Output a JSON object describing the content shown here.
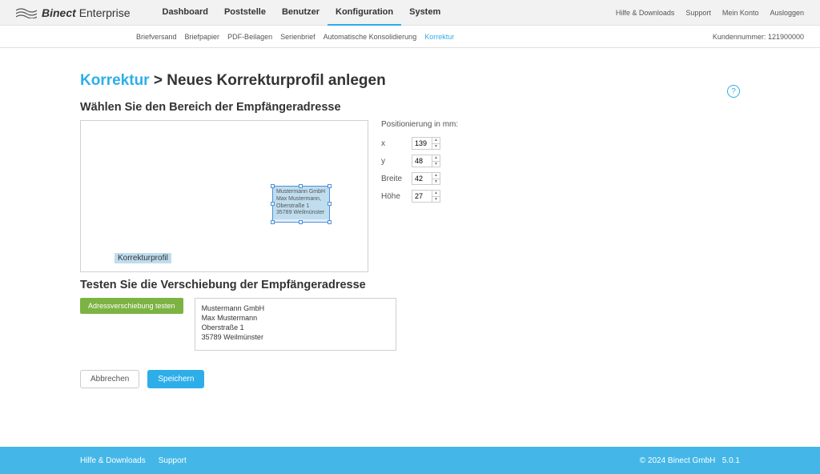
{
  "brand": {
    "bold": "Binect",
    "light": "Enterprise"
  },
  "main_nav": {
    "dashboard": "Dashboard",
    "poststelle": "Poststelle",
    "benutzer": "Benutzer",
    "konfiguration": "Konfiguration",
    "system": "System"
  },
  "top_right": {
    "hilfe": "Hilfe & Downloads",
    "support": "Support",
    "konto": "Mein Konto",
    "ausloggen": "Ausloggen"
  },
  "sub_nav": {
    "briefversand": "Briefversand",
    "briefpapier": "Briefpapier",
    "pdf": "PDF-Beilagen",
    "serienbrief": "Serienbrief",
    "auto": "Automatische Konsolidierung",
    "korrektur": "Korrektur"
  },
  "kundennummer_label": "Kundennummer: ",
  "kundennummer_value": "121900000",
  "breadcrumb": {
    "link": "Korrektur",
    "sep": " > ",
    "current": "Neues Korrekturprofil anlegen"
  },
  "section1_heading": "Wählen Sie den Bereich der Empfängeradresse",
  "preview_addr": {
    "l1": "Mustermann GmbH",
    "l2": "Max Mustermann,",
    "l3": "Oberstraße 1",
    "l4": "35789 Weilmünster"
  },
  "profile_label": "Korrekturprofil",
  "positioning": {
    "title": "Positionierung in mm:",
    "x_label": "x",
    "y_label": "y",
    "breite_label": "Breite",
    "hoehe_label": "Höhe",
    "x": "139",
    "y": "48",
    "breite": "42",
    "hoehe": "27"
  },
  "section2_heading": "Testen Sie die Verschiebung der Empfängeradresse",
  "test_button": "Adressverschiebung testen",
  "test_addr": {
    "l1": "Mustermann GmbH",
    "l2": "Max Mustermann",
    "l3": "Oberstraße 1",
    "l4": "35789 Weilmünster"
  },
  "actions": {
    "cancel": "Abbrechen",
    "save": "Speichern"
  },
  "footer": {
    "hilfe": "Hilfe & Downloads",
    "support": "Support",
    "copyright": "© 2024 Binect GmbH",
    "version": "5.0.1"
  },
  "help_icon": "?"
}
